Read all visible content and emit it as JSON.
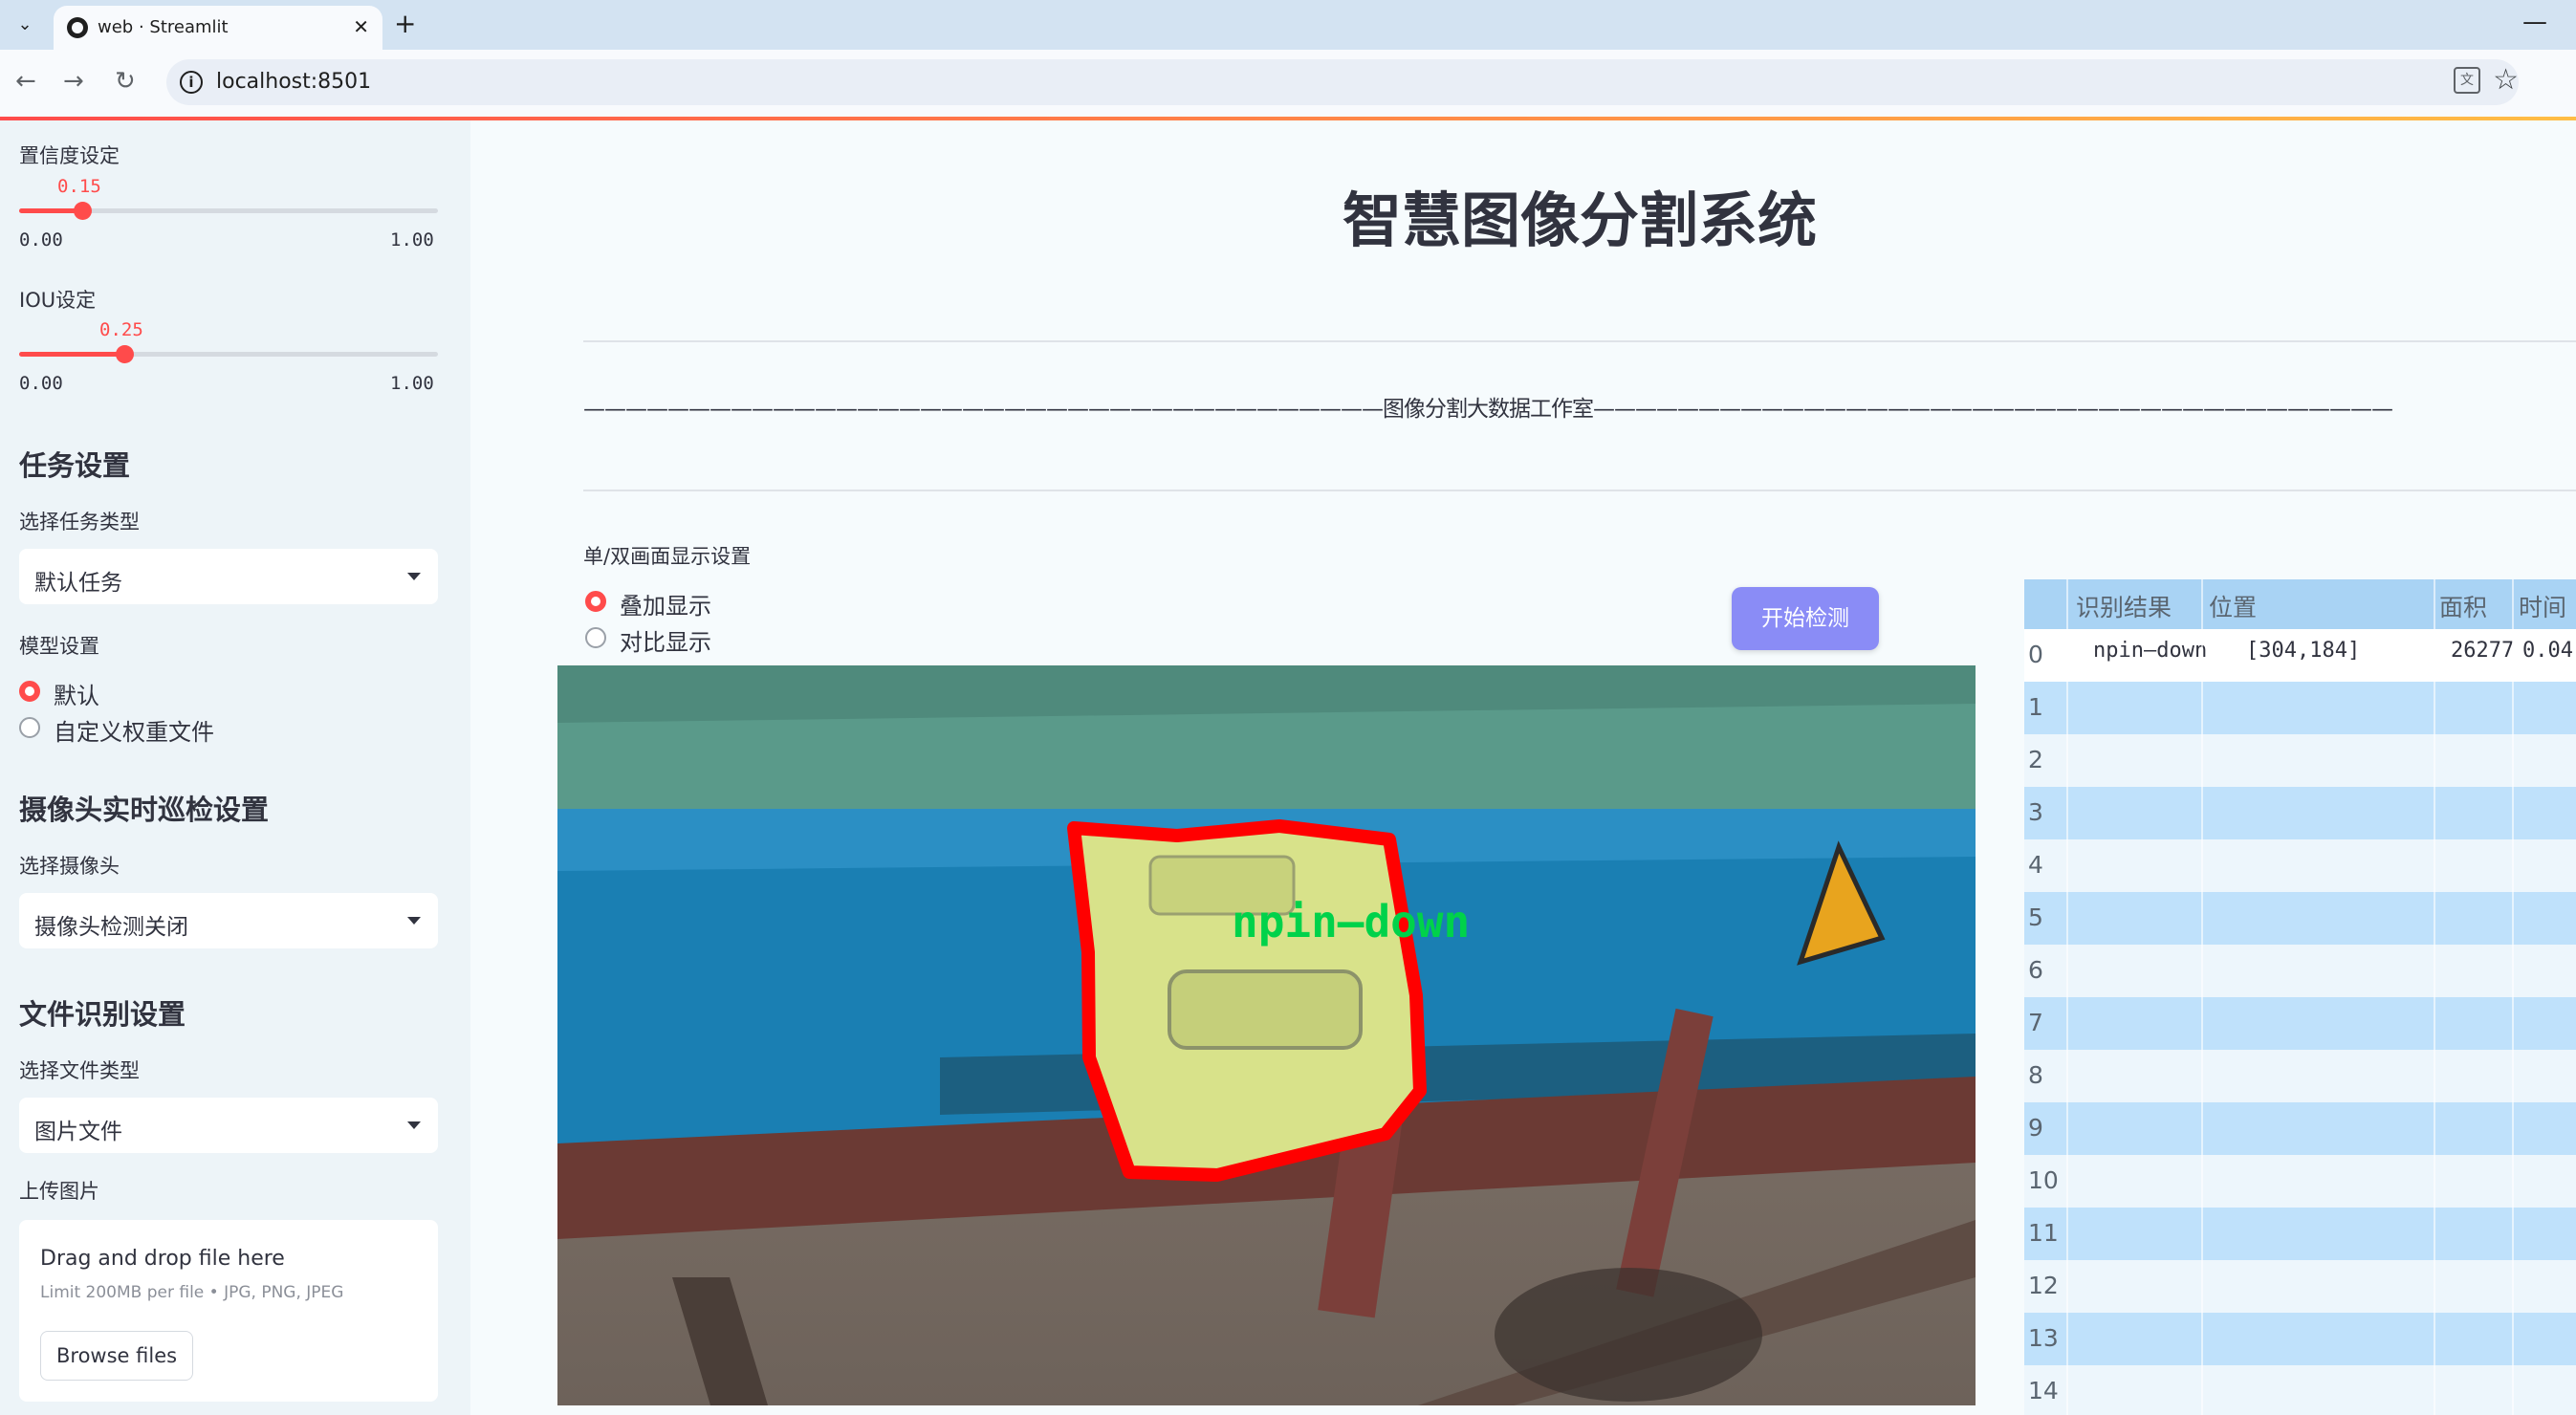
{
  "browser": {
    "tab_title": "web · Streamlit",
    "url": "localhost:8501"
  },
  "sidebar": {
    "confidence": {
      "label": "置信度设定",
      "value": "0.15",
      "value_num": 0.15,
      "min": "0.00",
      "max": "1.00"
    },
    "iou": {
      "label": "IOU设定",
      "value": "0.25",
      "value_num": 0.25,
      "min": "0.00",
      "max": "1.00"
    },
    "task_header": "任务设置",
    "task_type_label": "选择任务类型",
    "task_type_value": "默认任务",
    "model_label": "模型设置",
    "model_options": [
      "默认",
      "自定义权重文件"
    ],
    "model_selected": "默认",
    "camera_header": "摄像头实时巡检设置",
    "camera_label": "选择摄像头",
    "camera_value": "摄像头检测关闭",
    "file_header": "文件识别设置",
    "file_type_label": "选择文件类型",
    "file_type_value": "图片文件",
    "upload_label": "上传图片",
    "upload_title": "Drag and drop file here",
    "upload_sub": "Limit 200MB per file • JPG, PNG, JPEG",
    "browse_label": "Browse files"
  },
  "main": {
    "title": "智慧图像分割系统",
    "divider_text": "——————————————————————————————————————图像分割大数据工作室——————————————————————————————————————",
    "mode_label": "单/双画面显示设置",
    "mode_options": [
      "叠加显示",
      "对比显示"
    ],
    "mode_selected": "叠加显示",
    "detect_button": "开始检测",
    "detection_label": "npin—down",
    "colors": {
      "accent": "#ff4b4b",
      "button": "#8a8cf6",
      "mask": "#ff0000",
      "label": "#00d24a"
    }
  },
  "table": {
    "headers": [
      "识别结果",
      "位置",
      "面积",
      "时间"
    ],
    "rows": [
      {
        "index": "0",
        "result": "npin—down",
        "position": "[304,184]",
        "area": "26277",
        "time": "0.04"
      },
      {
        "index": "1"
      },
      {
        "index": "2"
      },
      {
        "index": "3"
      },
      {
        "index": "4"
      },
      {
        "index": "5"
      },
      {
        "index": "6"
      },
      {
        "index": "7"
      },
      {
        "index": "8"
      },
      {
        "index": "9"
      },
      {
        "index": "10"
      },
      {
        "index": "11"
      },
      {
        "index": "12"
      },
      {
        "index": "13"
      },
      {
        "index": "14"
      }
    ]
  }
}
